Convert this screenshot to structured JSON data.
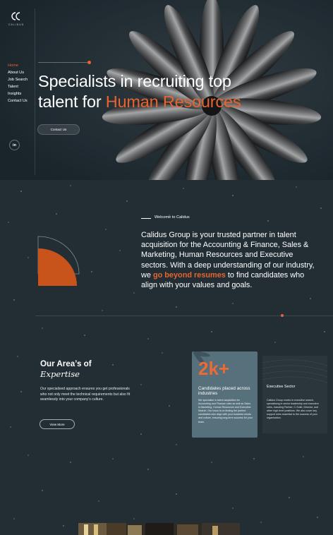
{
  "brand": {
    "name": "CALIDUS"
  },
  "nav": {
    "items": [
      {
        "label": "Home",
        "active": true
      },
      {
        "label": "About Us",
        "active": false
      },
      {
        "label": "Job Search",
        "active": false
      },
      {
        "label": "Talent",
        "active": false
      },
      {
        "label": "Insights",
        "active": false
      },
      {
        "label": "Contact Us",
        "active": false
      }
    ],
    "social_icon": "linkedin-icon",
    "social_label": "in"
  },
  "hero": {
    "title_line1": "Specialists in recruiting top",
    "title_line2_prefix": "talent for ",
    "title_accent": "Human Resources",
    "cta_label": "Contact Us"
  },
  "welcome": {
    "kicker": "Welcome to Calidus",
    "text_before": "Calidus Group is your trusted partner in talent acquisition for the Accounting & Finance, Sales & Marketing, Human Resources and Executive sectors. With a deep understanding of our industry, we ",
    "text_accent": "go beyond resumes",
    "text_after": " to find candidates who align with your values and goals."
  },
  "expertise": {
    "title": "Our Area’s of",
    "title_em": "Expertise",
    "description": "Our specialised approach ensures you get professionals who not only meet the technical requirements but also fit seamlessly into your company’s culture.",
    "button_label": "View More"
  },
  "stat_card": {
    "number": "2k+",
    "heading": "Candidates placed across industries",
    "body": "We specialise in talent acquisition for Accounting and Finance roles as well as Sales & Marketing, Human Resources and Executive Search. Our focus is on finding the perfect candidates who align with your business needs and culture, ensuring long-term success for your team."
  },
  "sector_card": {
    "heading": "Executive Sector",
    "body": "Calidus Group excels in executive search, specialising in senior leadership and executive roles, including Partner, C-Suite, Director, and other high-level positions. We also cover key support roles essential to the success of your organisation."
  },
  "colors": {
    "accent": "#e8642e",
    "background": "#222e34",
    "hero_background": "#1d2a31",
    "card": "#56707c"
  }
}
